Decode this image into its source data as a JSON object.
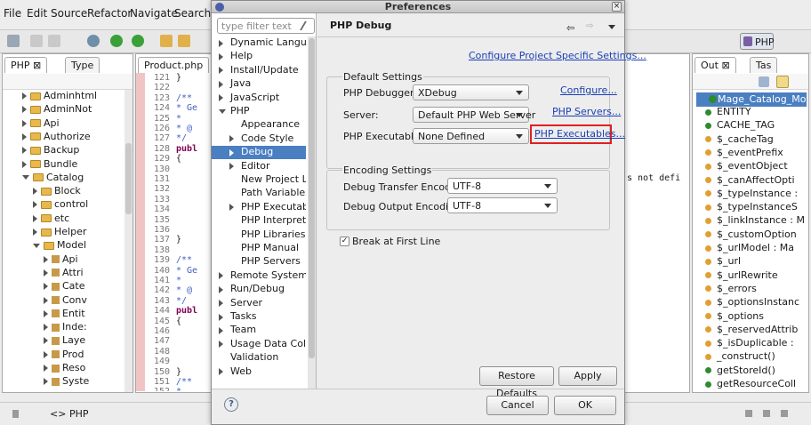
{
  "ide": {
    "menu": [
      "File",
      "Edit",
      "Source",
      "Refactor",
      "Navigate",
      "Search"
    ],
    "perspective_label": "PHP",
    "left_tabs": [
      "PHP",
      "Type"
    ],
    "editor_tab": "Product.php",
    "outline_tabs": [
      "Out",
      "Tas"
    ],
    "explorer_items": [
      {
        "label": "Adminhtml",
        "indent": 1,
        "expanded": false
      },
      {
        "label": "AdminNot",
        "indent": 1,
        "expanded": false
      },
      {
        "label": "Api",
        "indent": 1,
        "expanded": false
      },
      {
        "label": "Authorize",
        "indent": 1,
        "expanded": false
      },
      {
        "label": "Backup",
        "indent": 1,
        "expanded": false
      },
      {
        "label": "Bundle",
        "indent": 1,
        "expanded": false
      },
      {
        "label": "Catalog",
        "indent": 1,
        "expanded": true
      },
      {
        "label": "Block",
        "indent": 2,
        "expanded": false
      },
      {
        "label": "control",
        "indent": 2,
        "expanded": false
      },
      {
        "label": "etc",
        "indent": 2,
        "expanded": false
      },
      {
        "label": "Helper",
        "indent": 2,
        "expanded": false
      },
      {
        "label": "Model",
        "indent": 2,
        "expanded": true
      },
      {
        "label": "Api",
        "indent": 3,
        "expanded": false
      },
      {
        "label": "Attri",
        "indent": 3,
        "expanded": false
      },
      {
        "label": "Cate",
        "indent": 3,
        "expanded": false
      },
      {
        "label": "Conv",
        "indent": 3,
        "expanded": false
      },
      {
        "label": "Entit",
        "indent": 3,
        "expanded": false
      },
      {
        "label": "Inde:",
        "indent": 3,
        "expanded": false
      },
      {
        "label": "Laye",
        "indent": 3,
        "expanded": false
      },
      {
        "label": "Prod",
        "indent": 3,
        "expanded": false
      },
      {
        "label": "Reso",
        "indent": 3,
        "expanded": false
      },
      {
        "label": "Syste",
        "indent": 3,
        "expanded": false
      }
    ],
    "code_lines": [
      {
        "n": "121",
        "t": "    }"
      },
      {
        "n": "122",
        "t": ""
      },
      {
        "n": "123",
        "t": "    /**"
      },
      {
        "n": "124",
        "t": "     * Ge"
      },
      {
        "n": "125",
        "t": "     *"
      },
      {
        "n": "126",
        "t": "     * @"
      },
      {
        "n": "127",
        "t": "     */"
      },
      {
        "n": "128",
        "t": "    publ"
      },
      {
        "n": "129",
        "t": "    {"
      },
      {
        "n": "130",
        "t": ""
      },
      {
        "n": "131",
        "t": ""
      },
      {
        "n": "132",
        "t": ""
      },
      {
        "n": "133",
        "t": ""
      },
      {
        "n": "134",
        "t": ""
      },
      {
        "n": "135",
        "t": ""
      },
      {
        "n": "136",
        "t": ""
      },
      {
        "n": "137",
        "t": "    }"
      },
      {
        "n": "138",
        "t": ""
      },
      {
        "n": "139",
        "t": "    /**"
      },
      {
        "n": "140",
        "t": "     * Ge"
      },
      {
        "n": "141",
        "t": "     *"
      },
      {
        "n": "142",
        "t": "     * @"
      },
      {
        "n": "143",
        "t": "     */"
      },
      {
        "n": "144",
        "t": "    publ"
      },
      {
        "n": "145",
        "t": "    {"
      },
      {
        "n": "146",
        "t": ""
      },
      {
        "n": "147",
        "t": ""
      },
      {
        "n": "148",
        "t": ""
      },
      {
        "n": "149",
        "t": ""
      },
      {
        "n": "150",
        "t": "    }"
      },
      {
        "n": "151",
        "t": "    /**"
      },
      {
        "n": "152",
        "t": "     * "
      }
    ],
    "code_overflow_text": "s not defi",
    "outline_title": "Mage_Catalog_Mo",
    "outline_items": [
      {
        "label": "ENTITY",
        "color": "#2e8b2e"
      },
      {
        "label": "CACHE_TAG",
        "color": "#2e8b2e"
      },
      {
        "label": "$_cacheTag",
        "color": "#e0a030"
      },
      {
        "label": "$_eventPrefix",
        "color": "#e0a030"
      },
      {
        "label": "$_eventObject",
        "color": "#e0a030"
      },
      {
        "label": "$_canAffectOpti",
        "color": "#e0a030"
      },
      {
        "label": "$_typeInstance :",
        "color": "#e0a030"
      },
      {
        "label": "$_typeInstanceS",
        "color": "#e0a030"
      },
      {
        "label": "$_linkInstance : M",
        "color": "#e0a030"
      },
      {
        "label": "$_customOption",
        "color": "#e0a030"
      },
      {
        "label": "$_urlModel : Ma",
        "color": "#e0a030"
      },
      {
        "label": "$_url",
        "color": "#e0a030"
      },
      {
        "label": "$_urlRewrite",
        "color": "#e0a030"
      },
      {
        "label": "$_errors",
        "color": "#e0a030"
      },
      {
        "label": "$_optionsInstanc",
        "color": "#e0a030"
      },
      {
        "label": "$_options",
        "color": "#e0a030"
      },
      {
        "label": "$_reservedAttrib",
        "color": "#e0a030"
      },
      {
        "label": "$_isDuplicable :",
        "color": "#e0a030"
      },
      {
        "label": "_construct()",
        "color": "#e0a030"
      },
      {
        "label": "getStoreId()",
        "color": "#2e8b2e"
      },
      {
        "label": "getResourceColl",
        "color": "#2e8b2e"
      }
    ],
    "status_text": "PHP"
  },
  "dialog": {
    "title": "Preferences",
    "filter_placeholder": "type filter text",
    "page_title": "PHP Debug",
    "configure_project_link": "Configure Project Specific Settings...",
    "tree": [
      {
        "label": "Dynamic Language",
        "indent": 0,
        "arrow": "right",
        "selected": false
      },
      {
        "label": "Help",
        "indent": 0,
        "arrow": "right",
        "selected": false
      },
      {
        "label": "Install/Update",
        "indent": 0,
        "arrow": "right",
        "selected": false
      },
      {
        "label": "Java",
        "indent": 0,
        "arrow": "right",
        "selected": false
      },
      {
        "label": "JavaScript",
        "indent": 0,
        "arrow": "right",
        "selected": false
      },
      {
        "label": "PHP",
        "indent": 0,
        "arrow": "down",
        "selected": false
      },
      {
        "label": "Appearance",
        "indent": 1,
        "arrow": "none",
        "selected": false
      },
      {
        "label": "Code Style",
        "indent": 1,
        "arrow": "right",
        "selected": false
      },
      {
        "label": "Debug",
        "indent": 1,
        "arrow": "right",
        "selected": true
      },
      {
        "label": "Editor",
        "indent": 1,
        "arrow": "right",
        "selected": false
      },
      {
        "label": "New Project Lay",
        "indent": 1,
        "arrow": "none",
        "selected": false
      },
      {
        "label": "Path Variables",
        "indent": 1,
        "arrow": "none",
        "selected": false
      },
      {
        "label": "PHP Executable",
        "indent": 1,
        "arrow": "right",
        "selected": false
      },
      {
        "label": "PHP Interpreter",
        "indent": 1,
        "arrow": "none",
        "selected": false
      },
      {
        "label": "PHP Libraries",
        "indent": 1,
        "arrow": "none",
        "selected": false
      },
      {
        "label": "PHP Manual",
        "indent": 1,
        "arrow": "none",
        "selected": false
      },
      {
        "label": "PHP Servers",
        "indent": 1,
        "arrow": "none",
        "selected": false
      },
      {
        "label": "Remote Systems",
        "indent": 0,
        "arrow": "right",
        "selected": false
      },
      {
        "label": "Run/Debug",
        "indent": 0,
        "arrow": "right",
        "selected": false
      },
      {
        "label": "Server",
        "indent": 0,
        "arrow": "right",
        "selected": false
      },
      {
        "label": "Tasks",
        "indent": 0,
        "arrow": "right",
        "selected": false
      },
      {
        "label": "Team",
        "indent": 0,
        "arrow": "right",
        "selected": false
      },
      {
        "label": "Usage Data Collect",
        "indent": 0,
        "arrow": "right",
        "selected": false
      },
      {
        "label": "Validation",
        "indent": 0,
        "arrow": "none",
        "selected": false
      },
      {
        "label": "Web",
        "indent": 0,
        "arrow": "right",
        "selected": false
      }
    ],
    "default_settings": {
      "legend": "Default Settings",
      "debugger_label": "PHP Debugger:",
      "debugger_value": "XDebug",
      "configure_link": "Configure...",
      "server_label": "Server:",
      "server_value": "Default PHP Web Server",
      "servers_link": "PHP Servers...",
      "executable_label": "PHP Executable:",
      "executable_value": "None Defined",
      "executables_link": "PHP Executables..."
    },
    "encoding_settings": {
      "legend": "Encoding Settings",
      "transfer_label": "Debug Transfer Encoding",
      "transfer_value": "UTF-8",
      "output_label": "Debug Output Encoding",
      "output_value": "UTF-8"
    },
    "break_first_line": {
      "label": "Break at First Line",
      "checked": true
    },
    "restore_defaults": "Restore Defaults",
    "apply": "Apply",
    "cancel": "Cancel",
    "ok": "OK",
    "help_glyph": "?",
    "highlight_color": "#e02020"
  }
}
